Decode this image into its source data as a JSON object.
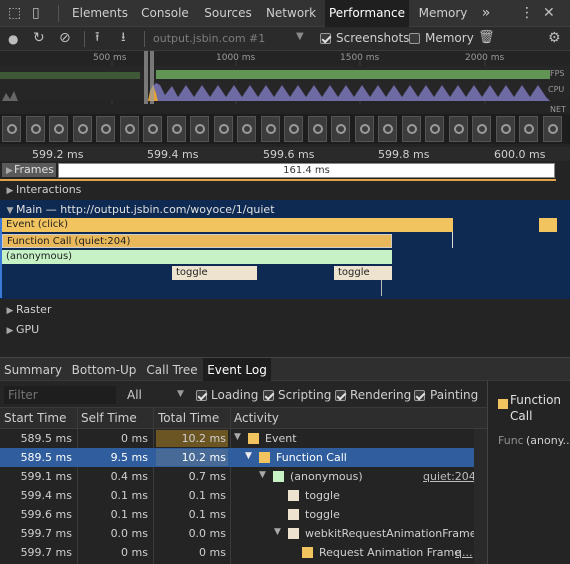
{
  "tabs": [
    "Elements",
    "Console",
    "Sources",
    "Network",
    "Performance",
    "Memory"
  ],
  "tab_more": "»",
  "toolbar": {
    "url": "output.jsbin.com #1",
    "screenshots_label": "Screenshots",
    "memory_label": "Memory"
  },
  "overview": {
    "ticks": [
      "500 ms",
      "1000 ms",
      "1500 ms",
      "2000 ms"
    ],
    "fps_label": "FPS",
    "cpu_label": "CPU",
    "net_label": "NET"
  },
  "ruler": [
    "599.2 ms",
    "599.4 ms",
    "599.6 ms",
    "599.8 ms",
    "600.0 ms"
  ],
  "tracks": {
    "frames_label": "Frames",
    "frame_duration": "161.4 ms",
    "interactions_label": "Interactions",
    "main_label": "Main — http://output.jsbin.com/woyoce/1/quiet",
    "raster_label": "Raster",
    "gpu_label": "GPU"
  },
  "flame": {
    "event": "Event (click)",
    "function_call": "Function Call (quiet:204)",
    "anonymous": "(anonymous)",
    "toggle1": "toggle",
    "toggle2": "toggle"
  },
  "subtabs": [
    "Summary",
    "Bottom-Up",
    "Call Tree",
    "Event Log"
  ],
  "filter": {
    "placeholder": "Filter",
    "all_label": "All",
    "loading": "Loading",
    "scripting": "Scripting",
    "rendering": "Rendering",
    "painting": "Painting"
  },
  "table": {
    "headers": [
      "Start Time",
      "Self Time",
      "Total Time",
      "Activity"
    ],
    "rows": [
      {
        "start": "589.5 ms",
        "self": "0 ms",
        "total": "10.2 ms",
        "activity": "Event",
        "link": ""
      },
      {
        "start": "589.5 ms",
        "self": "9.5 ms",
        "total": "10.2 ms",
        "activity": "Function Call",
        "link": ""
      },
      {
        "start": "599.1 ms",
        "self": "0.4 ms",
        "total": "0.7 ms",
        "activity": "(anonymous)",
        "link": "quiet:204"
      },
      {
        "start": "599.4 ms",
        "self": "0.1 ms",
        "total": "0.1 ms",
        "activity": "toggle",
        "link": ""
      },
      {
        "start": "599.6 ms",
        "self": "0.1 ms",
        "total": "0.1 ms",
        "activity": "toggle",
        "link": ""
      },
      {
        "start": "599.7 ms",
        "self": "0.0 ms",
        "total": "0.0 ms",
        "activity": "webkitRequestAnimationFrame",
        "link": ""
      },
      {
        "start": "599.7 ms",
        "self": "0 ms",
        "total": "0 ms",
        "activity": "Request Animation Frame",
        "link": "q..."
      }
    ]
  },
  "details": {
    "title": "Function Call",
    "func_label": "Func",
    "func_value": "(anony..."
  },
  "colors": {
    "scripting": "#f2c45f",
    "anonymous": "#c6f2c6",
    "toggle": "#eee3cf",
    "main_bg": "#0e2a52",
    "selected": "#2f5d9e"
  }
}
